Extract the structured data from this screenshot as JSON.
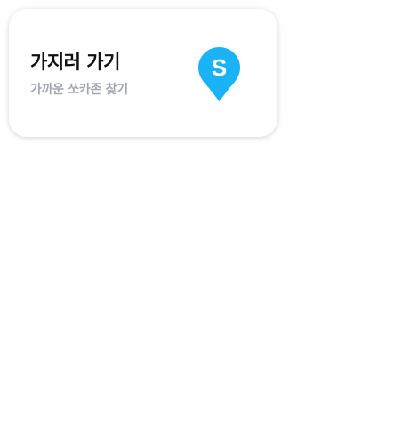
{
  "card": {
    "title": "가지러 가기",
    "subtitle": "가까운 쏘카존 찾기",
    "icon": "socar-location-pin-icon",
    "icon_letter": "S",
    "accent_color": "#1ab3f6"
  }
}
